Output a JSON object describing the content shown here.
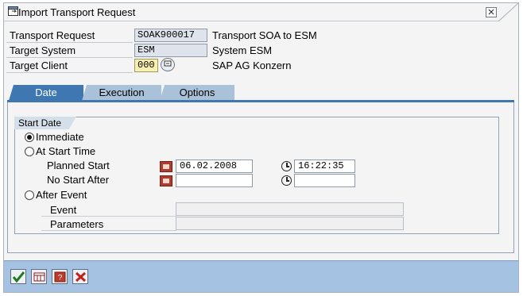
{
  "window": {
    "title": "Import Transport Request"
  },
  "header": {
    "transport_request": {
      "label": "Transport Request",
      "value": "SOAK900017",
      "description": "Transport SOA to ESM"
    },
    "target_system": {
      "label": "Target System",
      "value": "ESM",
      "description": "System ESM"
    },
    "target_client": {
      "label": "Target Client",
      "value": "000",
      "description": "SAP AG Konzern"
    }
  },
  "tabs": [
    {
      "label": "Date",
      "active": true
    },
    {
      "label": "Execution",
      "active": false
    },
    {
      "label": "Options",
      "active": false
    }
  ],
  "start_date": {
    "group_title": "Start Date",
    "immediate_label": "Immediate",
    "at_start_time_label": "At Start Time",
    "planned_start_label": "Planned Start",
    "planned_start_date": "06.02.2008",
    "planned_start_time": "16:22:35",
    "no_start_after_label": "No Start After",
    "no_start_after_date": "",
    "no_start_after_time": "",
    "after_event_label": "After Event",
    "event_label": "Event",
    "event_value": "",
    "parameters_label": "Parameters",
    "parameters_value": "",
    "selected": "Immediate"
  },
  "colors": {
    "tab_active": "#3e77b2",
    "tab_inactive": "#a9c1d9",
    "footer_bg": "#a6c2e2",
    "required_field": "#f8f0b0"
  },
  "footer": {
    "buttons": [
      "continue-icon",
      "schedule-icon",
      "help-icon",
      "cancel-icon"
    ]
  }
}
